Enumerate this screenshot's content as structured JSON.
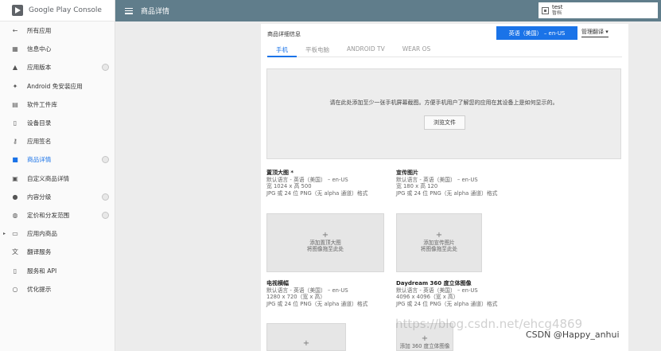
{
  "brand": {
    "name": "Google Play Console",
    "color": "#01875f"
  },
  "header": {
    "title": "商品详情",
    "account_name": "test",
    "account_sub": "暂档"
  },
  "sidebar": {
    "items": [
      {
        "label": "所有应用",
        "icon": "arrow-left-icon",
        "glyph": "←"
      },
      {
        "label": "信息中心",
        "icon": "dashboard-icon",
        "glyph": "▦"
      },
      {
        "label": "应用版本",
        "icon": "rocket-icon",
        "glyph": "▲",
        "check": true
      },
      {
        "label": "Android 免安装应用",
        "icon": "instant-app-icon",
        "glyph": "✦"
      },
      {
        "label": "软件工件库",
        "icon": "library-icon",
        "glyph": "▤"
      },
      {
        "label": "设备目录",
        "icon": "device-catalog-icon",
        "glyph": "▯"
      },
      {
        "label": "应用签名",
        "icon": "key-icon",
        "glyph": "⚷"
      },
      {
        "label": "商品详情",
        "icon": "store-icon",
        "glyph": "■",
        "check": true,
        "active": true
      },
      {
        "label": "自定义商品详情",
        "icon": "custom-store-icon",
        "glyph": "▣"
      },
      {
        "label": "内容分级",
        "icon": "rating-icon",
        "glyph": "●",
        "check": true
      },
      {
        "label": "定价和分发范围",
        "icon": "globe-icon",
        "glyph": "◍",
        "check": true
      },
      {
        "label": "应用内商品",
        "icon": "in-app-products-icon",
        "glyph": "▭",
        "caret": true
      },
      {
        "label": "翻译服务",
        "icon": "translate-icon",
        "glyph": "文"
      },
      {
        "label": "服务和 API",
        "icon": "api-icon",
        "glyph": "▯"
      },
      {
        "label": "优化提示",
        "icon": "lightbulb-icon",
        "glyph": "○"
      }
    ]
  },
  "main": {
    "section_title": "商品详细信息",
    "language_button": "英语（美国） – en-US",
    "manage_translations": "管理翻译 ▾",
    "tabs": [
      {
        "label": "手机",
        "active": true
      },
      {
        "label": "平板电脑"
      },
      {
        "label": "ANDROID TV"
      },
      {
        "label": "WEAR OS"
      }
    ],
    "screenshots_hint": "请在此处添加至少一张手机屏幕截图。方便手机用户了解您的应用在其设备上是如何显示的。",
    "browse_button": "浏览文件",
    "assets": [
      {
        "title": "置顶大图 *",
        "lines": [
          "默认语言 - 英语（美国） – en-US",
          "宽 1024 x 高 500",
          "JPG 或 24 位 PNG（无 alpha 通道）格式"
        ],
        "drop_line1": "添加置顶大图",
        "drop_line2": "将图像拖至此处"
      },
      {
        "title": "宣传图片",
        "lines": [
          "默认语言 - 英语（美国） – en-US",
          "宽 180 x 高 120",
          "JPG 或 24 位 PNG（无 alpha 通道）格式"
        ],
        "drop_line1": "添加宣传图片",
        "drop_line2": "将图像拖至此处"
      },
      {
        "title": "电视横幅",
        "lines": [
          "默认语言 - 英语（美国） – en-US",
          "1280 x 720（宽 x 高）",
          "JPG 或 24 位 PNG（无 alpha 通道）格式"
        ]
      },
      {
        "title": "Daydream 360 度立体图像",
        "lines": [
          "默认语言 - 英语（美国） – en-US",
          "4096 x 4096（宽 x 高）",
          "JPG 或 24 位 PNG（无 alpha 通道）格式"
        ],
        "drop_line1": "添加 360 度立体图像"
      }
    ]
  },
  "watermark": {
    "url": "https://blog.csdn.net/ehcg4869",
    "credit": "CSDN @Happy_anhui"
  }
}
